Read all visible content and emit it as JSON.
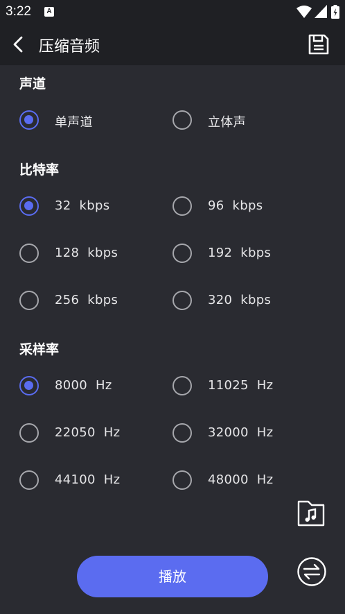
{
  "status_bar": {
    "time": "3:22",
    "notification_icon": "A",
    "icons": [
      "wifi-icon",
      "signal-icon",
      "battery-icon"
    ]
  },
  "app_bar": {
    "title": "压缩音频",
    "back_icon": "chevron-left-icon",
    "save_icon": "save-icon"
  },
  "channel": {
    "title": "声道",
    "options": [
      {
        "label": "单声道",
        "checked": true
      },
      {
        "label": "立体声",
        "checked": false
      }
    ]
  },
  "bitrate": {
    "title": "比特率",
    "options": [
      {
        "label": "32  kbps",
        "checked": true
      },
      {
        "label": "96  kbps",
        "checked": false
      },
      {
        "label": "128  kbps",
        "checked": false
      },
      {
        "label": "192  kbps",
        "checked": false
      },
      {
        "label": "256  kbps",
        "checked": false
      },
      {
        "label": "320  kbps",
        "checked": false
      }
    ]
  },
  "sample_rate": {
    "title": "采样率",
    "options": [
      {
        "label": "8000  Hz",
        "checked": true
      },
      {
        "label": "11025  Hz",
        "checked": false
      },
      {
        "label": "22050  Hz",
        "checked": false
      },
      {
        "label": "32000  Hz",
        "checked": false
      },
      {
        "label": "44100  Hz",
        "checked": false
      },
      {
        "label": "48000  Hz",
        "checked": false
      }
    ]
  },
  "actions": {
    "play_label": "播放",
    "folder_icon": "music-folder-icon",
    "swap_icon": "swap-icon"
  },
  "colors": {
    "accent": "#5b6cf0",
    "background": "#2a2b31",
    "header": "#1f2024"
  }
}
